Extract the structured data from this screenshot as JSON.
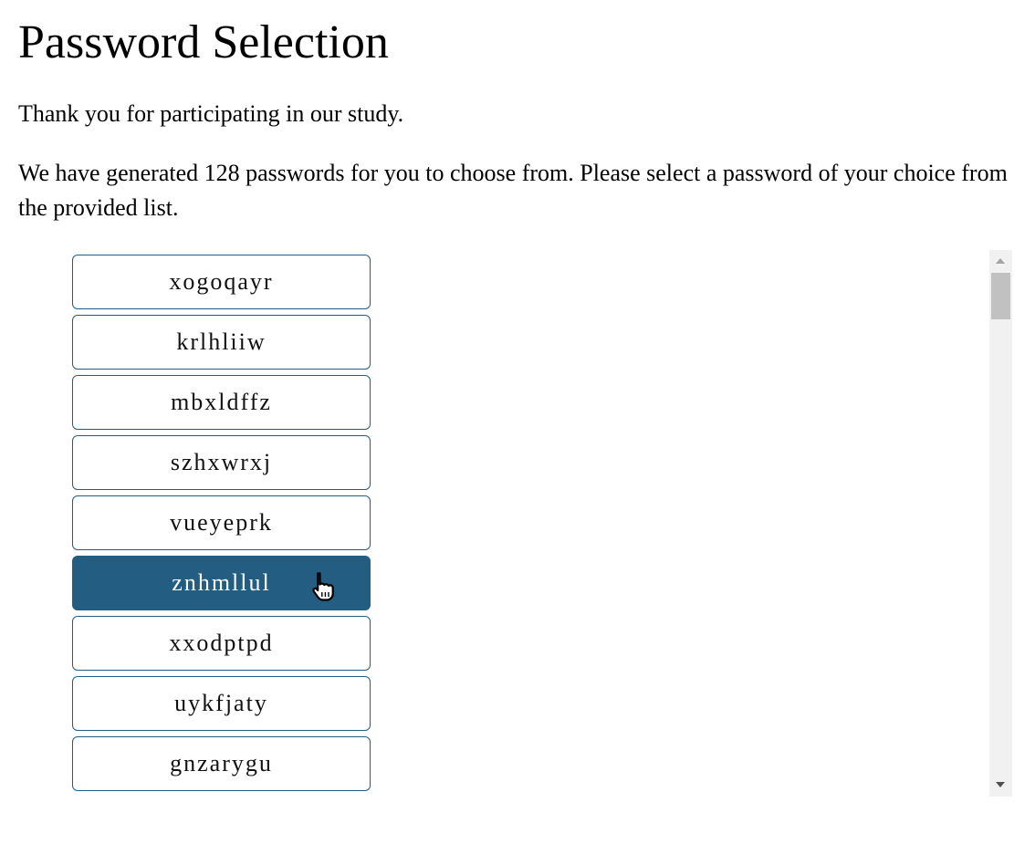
{
  "page": {
    "title": "Password Selection",
    "intro": "Thank you for participating in our study.",
    "instructions": "We have generated 128 passwords for you to choose from. Please select a password of your choice from the provided list."
  },
  "passwords": {
    "items": [
      {
        "label": "xogoqayr"
      },
      {
        "label": "krlhliiw"
      },
      {
        "label": "mbxldffz"
      },
      {
        "label": "szhxwrxj"
      },
      {
        "label": "vueyeprk"
      },
      {
        "label": "znhmllul",
        "selected": true
      },
      {
        "label": "xxodptpd"
      },
      {
        "label": "uykfjaty"
      },
      {
        "label": "gnzarygu"
      }
    ]
  },
  "colors": {
    "accent": "#245d82",
    "button_border": "#245d82",
    "selected_text": "#ffffff",
    "scrollbar_track": "#f1f1f1",
    "scrollbar_thumb": "#c1c1c1"
  },
  "icons": {
    "cursor": "hand-pointer-icon",
    "scroll_up": "scroll-up-arrow-icon",
    "scroll_down": "scroll-down-arrow-icon"
  }
}
